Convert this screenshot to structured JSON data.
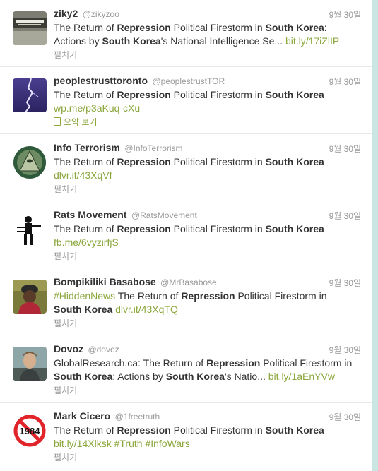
{
  "tweets": [
    {
      "fullname": "ziky2",
      "username": "@zikyzoo",
      "time": "9월 30일",
      "text_parts": [
        "The Return of ",
        "Repression",
        " Political Firestorm in ",
        "South Korea",
        ": Actions by ",
        "South Korea",
        "'s National Intelligence Se... "
      ],
      "link": "bit.ly/17iZlIP",
      "action": "펼치기"
    },
    {
      "fullname": "peoplestrusttoronto",
      "username": "@peoplestrustTOR",
      "time": "9월 30일",
      "text_parts": [
        "The Return of ",
        "Repression",
        " Political Firestorm in ",
        "South Korea"
      ],
      "link": "wp.me/p3aKuq-cXu",
      "action": "요약 보기"
    },
    {
      "fullname": "Info Terrorism",
      "username": "@InfoTerrorism",
      "time": "9월 30일",
      "text_parts": [
        "The Return of ",
        "Repression",
        " Political Firestorm in ",
        "South Korea"
      ],
      "link": "dlvr.it/43XqVf",
      "action": "펼치기"
    },
    {
      "fullname": "Rats Movement",
      "username": "@RatsMovement",
      "time": "9월 30일",
      "text_parts": [
        "The Return of ",
        "Repression",
        " Political Firestorm in ",
        "South Korea"
      ],
      "link": "fb.me/6vyzirfjS",
      "action": "펼치기"
    },
    {
      "fullname": "Bompikiliki Basabose",
      "username": "@MrBasabose",
      "time": "9월 30일",
      "hashtag": "#HiddenNews",
      "text_parts": [
        " The Return of ",
        "Repression",
        " Political Firestorm in ",
        "South Korea",
        " "
      ],
      "link": "dlvr.it/43XqTQ",
      "action": "펼치기"
    },
    {
      "fullname": "Dovoz",
      "username": "@dovoz",
      "time": "9월 30일",
      "text_parts": [
        "GlobalResearch.ca: The Return of ",
        "Repression",
        " Political Firestorm in ",
        "South Korea",
        ": Actions by ",
        "South Korea",
        "'s Natio... "
      ],
      "link": "bit.ly/1aEnYVw",
      "action": "펼치기"
    },
    {
      "fullname": "Mark Cicero",
      "username": "@1freetruth",
      "time": "9월 30일",
      "text_parts": [
        "The Return of ",
        "Repression",
        " Political Firestorm in ",
        "South Korea"
      ],
      "link": "bit.ly/14Xlksk",
      "tags": [
        "#Truth",
        "#InfoWars"
      ],
      "action": "펼치기",
      "avatar_text": "1984"
    }
  ]
}
